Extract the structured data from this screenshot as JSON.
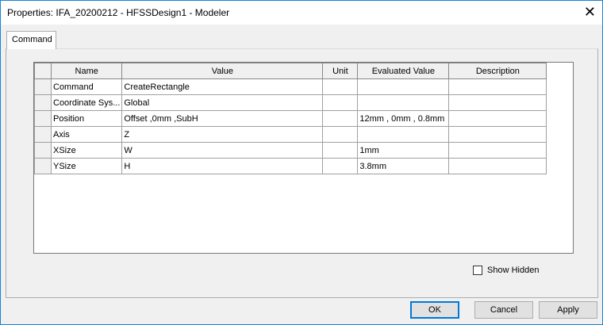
{
  "window": {
    "title": "Properties: IFA_20200212 - HFSSDesign1 - Modeler",
    "close_icon": "close-icon"
  },
  "tabs": [
    {
      "label": "Command"
    }
  ],
  "grid": {
    "columns": [
      "Name",
      "Value",
      "Unit",
      "Evaluated Value",
      "Description"
    ],
    "rows": [
      [
        "Command",
        "CreateRectangle",
        "",
        "",
        ""
      ],
      [
        "Coordinate Sys...",
        "Global",
        "",
        "",
        ""
      ],
      [
        "Position",
        "Offset ,0mm ,SubH",
        "",
        "12mm , 0mm , 0.8mm",
        ""
      ],
      [
        "Axis",
        "Z",
        "",
        "",
        ""
      ],
      [
        "XSize",
        "W",
        "",
        "1mm",
        ""
      ],
      [
        "YSize",
        "H",
        "",
        "3.8mm",
        ""
      ]
    ]
  },
  "show_hidden": {
    "label": "Show Hidden",
    "checked": false
  },
  "buttons": {
    "ok": "OK",
    "cancel": "Cancel",
    "apply": "Apply"
  }
}
